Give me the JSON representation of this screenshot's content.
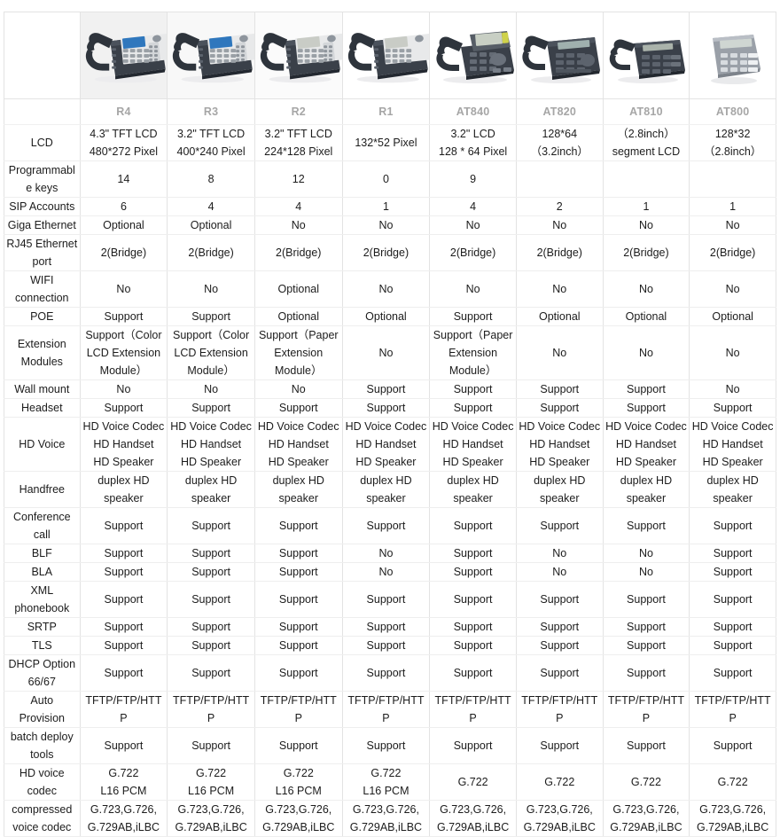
{
  "table": {
    "row_label_header": "",
    "models": [
      {
        "name": "R4",
        "photo": "ip-phone-color-lcd-large"
      },
      {
        "name": "R3",
        "photo": "ip-phone-color-lcd"
      },
      {
        "name": "R2",
        "photo": "ip-phone-mono-lcd"
      },
      {
        "name": "R1",
        "photo": "ip-phone-mono-lcd-small"
      },
      {
        "name": "AT840",
        "photo": "ip-phone-tilt-lcd"
      },
      {
        "name": "AT820",
        "photo": "ip-phone-basic-lcd"
      },
      {
        "name": "AT810",
        "photo": "ip-phone-segment-lcd"
      },
      {
        "name": "AT800",
        "photo": "ip-phone-silver-no-handset"
      }
    ],
    "rows": [
      {
        "label": "LCD",
        "height": "h2",
        "values": [
          [
            "4.3\" TFT LCD",
            "480*272 Pixel"
          ],
          [
            "3.2\" TFT LCD",
            "400*240 Pixel"
          ],
          [
            "3.2\" TFT LCD",
            "224*128 Pixel"
          ],
          [
            "132*52 Pixel"
          ],
          [
            "3.2\" LCD",
            "128 * 64 Pixel"
          ],
          [
            "128*64（3.2inch）"
          ],
          [
            "（2.8inch）",
            "segment LCD"
          ],
          [
            "128*32（2.8inch）"
          ]
        ]
      },
      {
        "label": "Programmable keys",
        "height": "h2",
        "values": [
          [
            "14"
          ],
          [
            "8"
          ],
          [
            "12"
          ],
          [
            "0"
          ],
          [
            "9"
          ],
          [
            ""
          ],
          [
            ""
          ],
          [
            ""
          ]
        ]
      },
      {
        "label": "SIP Accounts",
        "height": "h1",
        "values": [
          [
            "6"
          ],
          [
            "4"
          ],
          [
            "4"
          ],
          [
            "1"
          ],
          [
            "4"
          ],
          [
            "2"
          ],
          [
            "1"
          ],
          [
            "1"
          ]
        ]
      },
      {
        "label": "Giga Ethernet",
        "height": "h1",
        "values": [
          [
            "Optional"
          ],
          [
            "Optional"
          ],
          [
            "No"
          ],
          [
            "No"
          ],
          [
            "No"
          ],
          [
            "No"
          ],
          [
            "No"
          ],
          [
            "No"
          ]
        ]
      },
      {
        "label": "RJ45 Ethernet port",
        "height": "h2",
        "values": [
          [
            "2(Bridge)"
          ],
          [
            "2(Bridge)"
          ],
          [
            "2(Bridge)"
          ],
          [
            "2(Bridge)"
          ],
          [
            "2(Bridge)"
          ],
          [
            "2(Bridge)"
          ],
          [
            "2(Bridge)"
          ],
          [
            "2(Bridge)"
          ]
        ]
      },
      {
        "label": "WIFI connection",
        "height": "h2",
        "values": [
          [
            "No"
          ],
          [
            "No"
          ],
          [
            "Optional"
          ],
          [
            "No"
          ],
          [
            "No"
          ],
          [
            "No"
          ],
          [
            "No"
          ],
          [
            "No"
          ]
        ]
      },
      {
        "label": "POE",
        "height": "h1",
        "values": [
          [
            "Support"
          ],
          [
            "Support"
          ],
          [
            "Optional"
          ],
          [
            "Optional"
          ],
          [
            "Support"
          ],
          [
            "Optional"
          ],
          [
            "Optional"
          ],
          [
            "Optional"
          ]
        ]
      },
      {
        "label": "Extension Modules",
        "height": "h3",
        "values": [
          [
            "Support（Color",
            "LCD Extension",
            "Module）"
          ],
          [
            "Support（Color",
            "LCD Extension",
            "Module）"
          ],
          [
            "Support（Paper",
            "Extension",
            "Module）"
          ],
          [
            "No"
          ],
          [
            "Support（Paper",
            "Extension",
            "Module）"
          ],
          [
            "No"
          ],
          [
            "No"
          ],
          [
            "No"
          ]
        ]
      },
      {
        "label": "Wall mount",
        "height": "h1",
        "values": [
          [
            "No"
          ],
          [
            "No"
          ],
          [
            "No"
          ],
          [
            "Support"
          ],
          [
            "Support"
          ],
          [
            "Support"
          ],
          [
            "Support"
          ],
          [
            "No"
          ]
        ]
      },
      {
        "label": "Headset",
        "height": "h1",
        "values": [
          [
            "Support"
          ],
          [
            "Support"
          ],
          [
            "Support"
          ],
          [
            "Support"
          ],
          [
            "Support"
          ],
          [
            "Support"
          ],
          [
            "Support"
          ],
          [
            "Support"
          ]
        ]
      },
      {
        "label": "HD Voice",
        "height": "h3",
        "values": [
          [
            "HD Voice Codec",
            "HD Handset",
            "HD Speaker"
          ],
          [
            "HD Voice Codec",
            "HD Handset",
            "HD Speaker"
          ],
          [
            "HD Voice Codec",
            "HD Handset",
            "HD Speaker"
          ],
          [
            "HD Voice Codec",
            "HD Handset",
            "HD Speaker"
          ],
          [
            "HD Voice Codec",
            "HD Handset",
            "HD Speaker"
          ],
          [
            "HD Voice Codec",
            "HD Handset",
            "HD Speaker"
          ],
          [
            "HD Voice Codec",
            "HD Handset",
            "HD Speaker"
          ],
          [
            "HD Voice Codec",
            "HD Handset",
            "HD Speaker"
          ]
        ]
      },
      {
        "label": "Handfree",
        "height": "h1",
        "values": [
          [
            "duplex HD speaker"
          ],
          [
            "duplex HD speaker"
          ],
          [
            "duplex HD speaker"
          ],
          [
            "duplex HD speaker"
          ],
          [
            "duplex HD speaker"
          ],
          [
            "duplex HD speaker"
          ],
          [
            "duplex HD speaker"
          ],
          [
            "duplex HD speaker"
          ]
        ]
      },
      {
        "label": "Conference call",
        "height": "h2",
        "values": [
          [
            "Support"
          ],
          [
            "Support"
          ],
          [
            "Support"
          ],
          [
            "Support"
          ],
          [
            "Support"
          ],
          [
            "Support"
          ],
          [
            "Support"
          ],
          [
            "Support"
          ]
        ]
      },
      {
        "label": "BLF",
        "height": "h1",
        "values": [
          [
            "Support"
          ],
          [
            "Support"
          ],
          [
            "Support"
          ],
          [
            "No"
          ],
          [
            "Support"
          ],
          [
            "No"
          ],
          [
            "No"
          ],
          [
            "Support"
          ]
        ]
      },
      {
        "label": "BLA",
        "height": "h1",
        "values": [
          [
            "Support"
          ],
          [
            "Support"
          ],
          [
            "Support"
          ],
          [
            "No"
          ],
          [
            "Support"
          ],
          [
            "No"
          ],
          [
            "No"
          ],
          [
            "Support"
          ]
        ]
      },
      {
        "label": "XML phonebook",
        "height": "h2",
        "values": [
          [
            "Support"
          ],
          [
            "Support"
          ],
          [
            "Support"
          ],
          [
            "Support"
          ],
          [
            "Support"
          ],
          [
            "Support"
          ],
          [
            "Support"
          ],
          [
            "Support"
          ]
        ]
      },
      {
        "label": "SRTP",
        "height": "h1",
        "values": [
          [
            "Support"
          ],
          [
            "Support"
          ],
          [
            "Support"
          ],
          [
            "Support"
          ],
          [
            "Support"
          ],
          [
            "Support"
          ],
          [
            "Support"
          ],
          [
            "Support"
          ]
        ]
      },
      {
        "label": "TLS",
        "height": "h1",
        "values": [
          [
            "Support"
          ],
          [
            "Support"
          ],
          [
            "Support"
          ],
          [
            "Support"
          ],
          [
            "Support"
          ],
          [
            "Support"
          ],
          [
            "Support"
          ],
          [
            "Support"
          ]
        ]
      },
      {
        "label": "DHCP Option 66/67",
        "height": "h2",
        "values": [
          [
            "Support"
          ],
          [
            "Support"
          ],
          [
            "Support"
          ],
          [
            "Support"
          ],
          [
            "Support"
          ],
          [
            "Support"
          ],
          [
            "Support"
          ],
          [
            "Support"
          ]
        ]
      },
      {
        "label": "Auto Provision",
        "height": "h1",
        "values": [
          [
            "TFTP/FTP/HTTP"
          ],
          [
            "TFTP/FTP/HTTP"
          ],
          [
            "TFTP/FTP/HTTP"
          ],
          [
            "TFTP/FTP/HTTP"
          ],
          [
            "TFTP/FTP/HTTP"
          ],
          [
            "TFTP/FTP/HTTP"
          ],
          [
            "TFTP/FTP/HTTP"
          ],
          [
            "TFTP/FTP/HTTP"
          ]
        ]
      },
      {
        "label": "batch deploy tools",
        "height": "h2",
        "values": [
          [
            "Support"
          ],
          [
            "Support"
          ],
          [
            "Support"
          ],
          [
            "Support"
          ],
          [
            "Support"
          ],
          [
            "Support"
          ],
          [
            "Support"
          ],
          [
            "Support"
          ]
        ]
      },
      {
        "label": "HD voice codec",
        "height": "h2",
        "values": [
          [
            "G.722",
            "L16 PCM"
          ],
          [
            "G.722",
            "L16 PCM"
          ],
          [
            "G.722",
            "L16 PCM"
          ],
          [
            "G.722",
            "L16 PCM"
          ],
          [
            "G.722"
          ],
          [
            "G.722"
          ],
          [
            "G.722"
          ],
          [
            "G.722"
          ]
        ]
      },
      {
        "label": "compressed voice codec",
        "height": "h2",
        "values": [
          [
            "G.723,G.726,",
            "G.729AB,iLBC"
          ],
          [
            "G.723,G.726,",
            "G.729AB,iLBC"
          ],
          [
            "G.723,G.726,",
            "G.729AB,iLBC"
          ],
          [
            "G.723,G.726,",
            "G.729AB,iLBC"
          ],
          [
            "G.723,G.726,",
            "G.729AB,iLBC"
          ],
          [
            "G.723,G.726,",
            "G.729AB,iLBC"
          ],
          [
            "G.723,G.726,",
            "G.729AB,iLBC"
          ],
          [
            "G.723,G.726,",
            "G.729AB,iLBC"
          ]
        ]
      }
    ]
  },
  "colors": {
    "border": "#e3e3e3",
    "row_border": "#eeeeee",
    "model_label": "#a6a6a6",
    "text": "#1c1c1c",
    "phone_body_dark": "#3a4049",
    "phone_body_silver": "#9aa0a8",
    "phone_screen_blue": "#2f77bd",
    "phone_screen_gray": "#c9ccc6",
    "phone_accent_yellow": "#cfd24a"
  }
}
